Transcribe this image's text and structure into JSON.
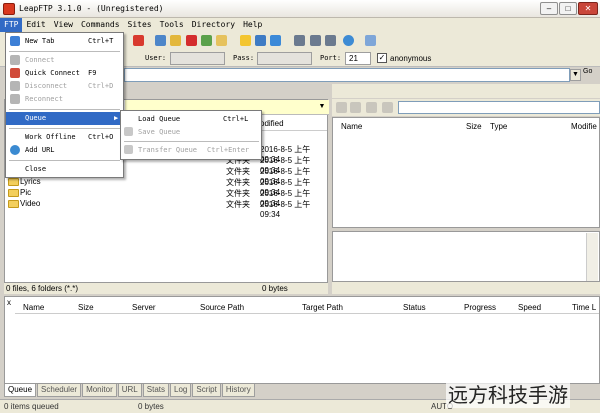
{
  "window": {
    "title": "LeapFTP 3.1.0 - (Unregistered)"
  },
  "menubar": [
    "FTP",
    "Edit",
    "View",
    "Commands",
    "Sites",
    "Tools",
    "Directory",
    "Help"
  ],
  "toolbar2": {
    "user_label": "User:",
    "pass_label": "Pass:",
    "port_label": "Port:",
    "port_value": "21",
    "anonymous_label": "anonymous",
    "anonymous_checked": "✓"
  },
  "address": {
    "go_label": "Go"
  },
  "ftp_menu": [
    {
      "label": "New Tab",
      "shortcut": "Ctrl+T",
      "icon": "new-tab-icon",
      "color": "#3c7fd6",
      "disabled": false
    },
    {
      "label": "Connect",
      "shortcut": "",
      "icon": "connect-icon",
      "color": "#b5b5b5",
      "disabled": true
    },
    {
      "label": "Quick Connect",
      "shortcut": "F9",
      "icon": "quick-connect-icon",
      "color": "#d14b3a",
      "disabled": false
    },
    {
      "label": "Disconnect",
      "shortcut": "Ctrl+D",
      "icon": "disconnect-icon",
      "color": "#b5b5b5",
      "disabled": true
    },
    {
      "label": "Reconnect",
      "shortcut": "",
      "icon": "reconnect-icon",
      "color": "#b5b5b5",
      "disabled": true
    },
    {
      "label": "Queue",
      "shortcut": "▶",
      "icon": "",
      "color": "",
      "disabled": false
    },
    {
      "label": "Work Offline",
      "shortcut": "Ctrl+O",
      "icon": "",
      "color": "",
      "disabled": false
    },
    {
      "label": "Add URL",
      "shortcut": "",
      "icon": "add-url-icon",
      "color": "#3a8ad1",
      "disabled": false
    },
    {
      "label": "Close",
      "shortcut": "",
      "icon": "",
      "color": "",
      "disabled": false
    }
  ],
  "queue_submenu": [
    {
      "label": "Load Queue",
      "shortcut": "Ctrl+L",
      "disabled": false
    },
    {
      "label": "Save Queue",
      "shortcut": "",
      "disabled": true
    },
    {
      "label": "Transfer Queue",
      "shortcut": "Ctrl+Enter",
      "disabled": true
    }
  ],
  "local": {
    "header": {
      "modified": "odified"
    },
    "rows": [
      {
        "name": "",
        "type": "文件夹",
        "modified": "2016-8-5 上午 09:34"
      },
      {
        "name": "",
        "type": "文件夹",
        "modified": "2016-8-5 上午 09:34"
      },
      {
        "name": "",
        "type": "文件夹",
        "modified": "2016-8-5 上午 09:34"
      },
      {
        "name": "Lyrics",
        "type": "文件夹",
        "modified": "2016-8-5 上午 09:34"
      },
      {
        "name": "Pic",
        "type": "文件夹",
        "modified": "2016-8-5 上午 09:34"
      },
      {
        "name": "Video",
        "type": "文件夹",
        "modified": "2016-8-5 上午 09:34"
      }
    ],
    "status_left": "0 files, 6 folders (*.*)",
    "status_right": "0 bytes"
  },
  "remote": {
    "columns": [
      "Name",
      "Size",
      "Type",
      "Modifie"
    ]
  },
  "queue": {
    "close_label": "x",
    "columns": [
      "Name",
      "Size",
      "Server",
      "Source Path",
      "Target Path",
      "Status",
      "Progress",
      "Speed",
      "Time L"
    ],
    "tabs": [
      "Queue",
      "Scheduler",
      "Monitor",
      "URL",
      "Stats",
      "Log",
      "Script",
      "History"
    ]
  },
  "statusbar": {
    "items": "0 items queued",
    "bytes": "0 bytes",
    "mode": "AUTO"
  },
  "watermark": "远方科技手游"
}
